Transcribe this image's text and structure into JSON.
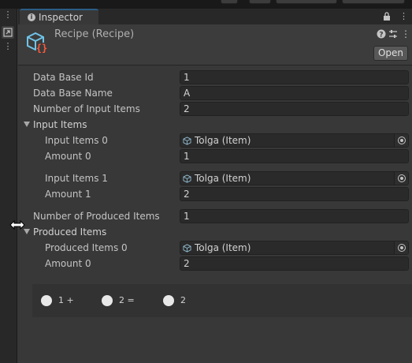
{
  "window": {
    "tab_label": "Inspector",
    "tab_icon": "info-icon"
  },
  "header": {
    "object_title": "Recipe (Recipe)",
    "object_icon": "scriptable-object-icon",
    "open_button": "Open",
    "accent_color": "#2c5d87"
  },
  "properties": {
    "data_base_id": {
      "label": "Data Base Id",
      "value": "1"
    },
    "data_base_name": {
      "label": "Data Base Name",
      "value": "A"
    },
    "number_of_input_items": {
      "label": "Number of Input Items",
      "value": "2"
    },
    "input_items_foldout": "Input Items",
    "input_items": [
      {
        "label": "Input Items 0",
        "value": "Tolga (Item)",
        "amount_label": "Amount 0",
        "amount": "1"
      },
      {
        "label": "Input Items 1",
        "value": "Tolga (Item)",
        "amount_label": "Amount 1",
        "amount": "2"
      }
    ],
    "number_of_produced_items": {
      "label": "Number of Produced Items",
      "value": "1"
    },
    "produced_items_foldout": "Produced Items",
    "produced_items": [
      {
        "label": "Produced Items 0",
        "value": "Tolga (Item)",
        "amount_label": "Amount 0",
        "amount": "2"
      }
    ]
  },
  "equation": [
    {
      "text": "1 +"
    },
    {
      "text": "2 ="
    },
    {
      "text": "2"
    }
  ]
}
